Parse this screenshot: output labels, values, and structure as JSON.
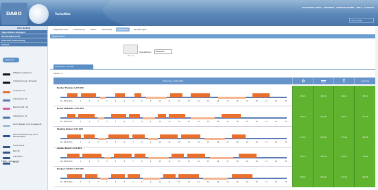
{
  "app": {
    "brand": "DABO",
    "product": "TachoWeb"
  },
  "topnav": {
    "items": [
      "ACTIVITIES DAILY",
      "REPORTS",
      "NOTIFICATIONS",
      "HELP",
      "LOGOUT"
    ],
    "user": "TW Center"
  },
  "sidebar": {
    "title": "UPS DATEN",
    "links": [
      "Tages-Daten anzeigen",
      "Wochenübersicht",
      "Zeitraum Auswertung",
      "Verlauf"
    ],
    "legend_button": "Legende",
    "legend": [
      {
        "label": "Tätigkeit unbekannt",
        "color": "#111111"
      },
      {
        "label": "Unterbrechung / Ruhezeit",
        "color": "#111111"
      },
      {
        "label": "Lenkzeit / 42",
        "color": "#e8702c"
      },
      {
        "label": "Arbeitszeit / 42",
        "color": "#5a7bb3"
      },
      {
        "label": "Bereitschaft / 42",
        "color": "#d35aa0"
      },
      {
        "label": "Arbeitszeit / 41",
        "color": "#4a76b3"
      },
      {
        "label": "Kontrollgerät nicht eingesteckt",
        "color": "#9fb9d7"
      },
      {
        "label": "Fahrt Unterbrechung durch Fährüberfahrt",
        "color": "#2f4f8f"
      },
      {
        "label": "Fahrer-Karte",
        "color": "#335588"
      },
      {
        "label": "Bericht",
        "color": "#335588"
      },
      {
        "label": "Aufnahme",
        "color": "#335588"
      },
      {
        "label": "Pause",
        "color": "#335588"
      }
    ],
    "version": "TWeb - Version 4.0"
  },
  "tabs": [
    "Tagesübersicht",
    "Auswertung",
    "Fahrer",
    "Fahrzeuge",
    "Tagesdaten",
    "Einstellungen"
  ],
  "active_tab_index": 4,
  "page": {
    "title": "Tages-Daten",
    "file_label": "PDF / XLS",
    "date_label": "Tag wählen:",
    "date_value": "08.12.2011"
  },
  "vehicle_tab": "FAHRZEUG 12113B",
  "driver_count": "Fahrer: 5",
  "table": {
    "timeline_header": "Zeitachse (Aktivität)",
    "columns": [
      "clock-icon",
      "bed-icon",
      "sum-icon",
      "Summe"
    ]
  },
  "rows": [
    {
      "name": "Becker Thomas",
      "id": "1-07.603",
      "cells": [
        "08:21",
        "08:00",
        "00:12",
        "08:11"
      ]
    },
    {
      "name": "Braun Matthias",
      "id": "1-07.603",
      "cells": [
        "06:12",
        "04:00",
        "00:12",
        "07:15"
      ]
    },
    {
      "name": "Eppling Jürgen",
      "id": "1-07.603",
      "cells": [
        "07:11",
        "04:00",
        "07:44",
        "08:45"
      ]
    },
    {
      "name": "Lehder Bernd",
      "id": "1-07.603",
      "cells": [
        "08:12",
        "08:00",
        "04:00",
        "11:02"
      ]
    },
    {
      "name": "Bergner Stefan",
      "id": "1-07.603",
      "cells": [
        "08:14",
        "08:00",
        "07:44",
        "09:35"
      ]
    }
  ],
  "ticks": [
    "Do., 08.12.2011",
    "1",
    "2",
    "3",
    "4",
    "5",
    "6",
    "7",
    "8",
    "9",
    "10",
    "11",
    "12",
    "13",
    "14",
    "15",
    "16",
    "17",
    "18",
    "19",
    "20",
    "21",
    "22",
    "23"
  ]
}
